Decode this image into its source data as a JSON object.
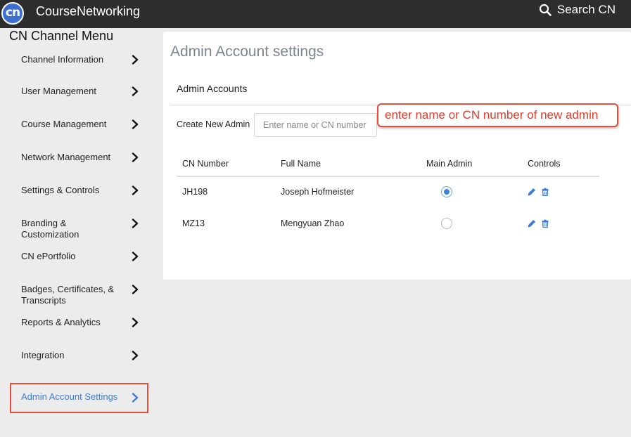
{
  "topbar": {
    "logo_text": "cn",
    "brand": "CourseNetworking",
    "search_label": "Search CN",
    "search_icon": "search-icon"
  },
  "sidebar": {
    "title": "CN Channel Menu",
    "items": [
      {
        "label": "Channel Information",
        "active": false
      },
      {
        "label": "User Management",
        "active": false
      },
      {
        "label": "Course Management",
        "active": false
      },
      {
        "label": "Network Management",
        "active": false
      },
      {
        "label": "Settings & Controls",
        "active": false
      },
      {
        "label": "Branding & Customization",
        "active": false
      },
      {
        "label": "CN ePortfolio",
        "active": false
      },
      {
        "label": "Badges, Certificates, & Transcripts",
        "active": false
      },
      {
        "label": "Reports & Analytics",
        "active": false
      },
      {
        "label": "Integration",
        "active": false
      },
      {
        "label": "Admin Account Settings",
        "active": true
      }
    ],
    "active_color": "#3d7bd4"
  },
  "main": {
    "page_title": "Admin Account settings",
    "section_title": "Admin Accounts",
    "create_label": "Create New Admin",
    "create_placeholder": "Enter name or CN number",
    "table": {
      "headers": [
        "CN Number",
        "Full Name",
        "Main Admin",
        "Controls"
      ],
      "rows": [
        {
          "cn_number": "JH198",
          "full_name": "Joseph Hofmeister",
          "main_admin": true
        },
        {
          "cn_number": "MZ13",
          "full_name": "Mengyuan Zhao",
          "main_admin": false
        }
      ],
      "control_icons": [
        "pencil-icon",
        "trash-icon"
      ]
    }
  },
  "annotation": {
    "callout_text": "enter name or CN number of new admin",
    "highlight_color": "#e94b3c"
  },
  "colors": {
    "topbar_bg": "#2d2d2d",
    "logo_blue": "#3d6fd1",
    "icon_blue": "#3b7dd8"
  }
}
